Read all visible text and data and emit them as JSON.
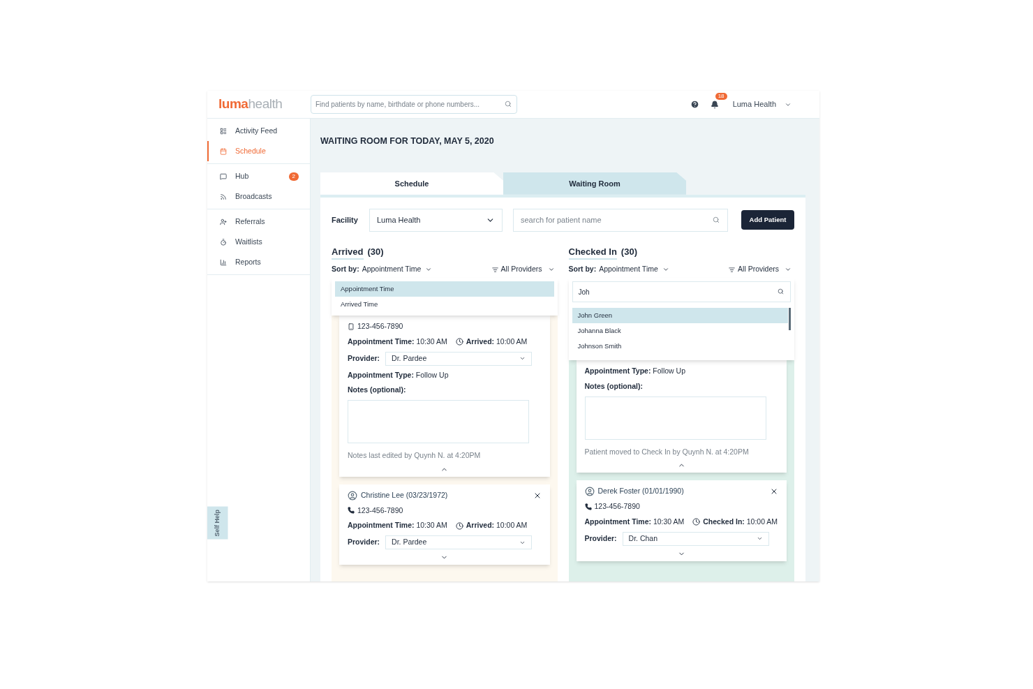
{
  "header": {
    "logo": {
      "accent": "luma",
      "rest": "health"
    },
    "search": {
      "placeholder": "Find patients by name, birthdate or phone numbers..."
    },
    "notifications": {
      "count": "18"
    },
    "user": {
      "name": "Luma Health"
    }
  },
  "sidebar": {
    "groups": [
      {
        "items": [
          {
            "label": "Activity Feed",
            "selected": false
          },
          {
            "label": "Schedule",
            "selected": true
          }
        ]
      },
      {
        "items": [
          {
            "label": "Hub",
            "selected": false,
            "badge": "2"
          },
          {
            "label": "Broadcasts",
            "selected": false
          }
        ]
      },
      {
        "items": [
          {
            "label": "Referrals",
            "selected": false
          },
          {
            "label": "Waitlists",
            "selected": false
          },
          {
            "label": "Reports",
            "selected": false
          }
        ]
      }
    ],
    "self_help": "Self Help"
  },
  "page": {
    "title": "WAITING ROOM FOR TODAY, MAY 5, 2020"
  },
  "tabs": [
    {
      "label": "Schedule",
      "selected": true
    },
    {
      "label": "Waiting Room",
      "selected": false
    }
  ],
  "toolbar": {
    "facility_label": "Facility",
    "facility": "Luma Health",
    "search": {
      "placeholder": "search for patient name"
    },
    "button": "Add Patient"
  },
  "columns": [
    {
      "title": "Arrived",
      "count": "(30)",
      "color": "#fdf8ef",
      "sort_label": "Sort by:",
      "sort_value": "Appointment Time",
      "filter": "All Providers",
      "dropdown": {
        "kind": "options",
        "options": [
          {
            "label": "Appointment Time",
            "selected": true
          },
          {
            "label": "Arrived Time",
            "selected": false
          }
        ]
      },
      "cards": [
        {
          "phone": {
            "kind": "mobile",
            "number": "123-456-7890"
          },
          "appointment": {
            "label": "Appointment Time:",
            "value": "10:30 AM"
          },
          "status": {
            "label": "Arrived:",
            "value": "10:00 AM"
          },
          "provider": {
            "label": "Provider:",
            "value": "Dr. Pardee"
          },
          "type": {
            "label": "Appointment Type:",
            "value": "Follow Up"
          },
          "notes": {
            "label": "Notes (optional):"
          },
          "footer": "Notes last edited by Quynh N. at 4:20PM",
          "expanded": true
        },
        {
          "name": "Christine Lee (03/23/1972)",
          "phone": {
            "kind": "landline",
            "number": "123-456-7890"
          },
          "appointment": {
            "label": "Appointment Time:",
            "value": "10:30 AM"
          },
          "status": {
            "label": "Arrived:",
            "value": "10:00 AM"
          },
          "provider": {
            "label": "Provider:",
            "value": "Dr. Pardee"
          },
          "expanded": false
        }
      ]
    },
    {
      "title": "Checked In",
      "count": "(30)",
      "color": "#ddf0ea",
      "sort_label": "Sort by:",
      "sort_value": "Appointment Time",
      "filter": "All Providers",
      "dropdown": {
        "kind": "search",
        "value": "Joh",
        "options": [
          {
            "label": "John Green",
            "selected": true
          },
          {
            "label": "Johanna Black",
            "selected": false
          },
          {
            "label": "Johnson Smith",
            "selected": false
          }
        ]
      },
      "cards": [
        {
          "type": {
            "label": "Appointment Type:",
            "value": "Follow Up"
          },
          "notes": {
            "label": "Notes (optional):"
          },
          "footer": "Patient moved to Check In by Quynh N. at 4:20PM",
          "expanded": true
        },
        {
          "name": "Derek Foster (01/01/1990)",
          "phone": {
            "kind": "landline",
            "number": "123-456-7890"
          },
          "appointment": {
            "label": "Appointment Time:",
            "value": "10:30 AM"
          },
          "status": {
            "label": "Checked In:",
            "value": "10:00 AM"
          },
          "provider": {
            "label": "Provider:",
            "value": "Dr. Chan"
          },
          "expanded": false
        }
      ]
    }
  ]
}
